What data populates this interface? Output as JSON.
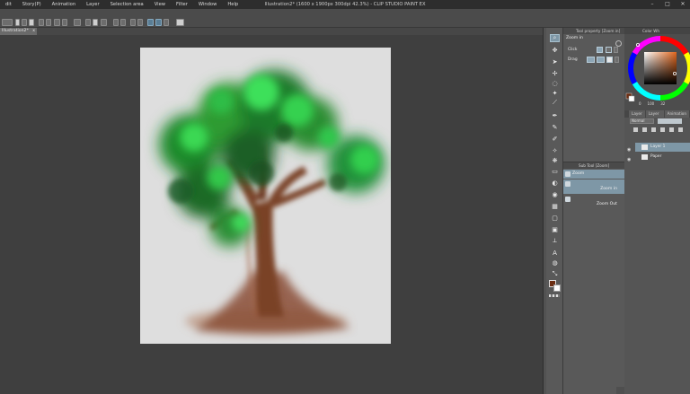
{
  "window": {
    "title": "Illustration2* (1600 x 1900px 300dpi 42.3%) - CLIP STUDIO PAINT EX",
    "minimize": "–",
    "maximize": "□",
    "close": "✕"
  },
  "menu": [
    "dit",
    "Story(P)",
    "Animation",
    "Layer",
    "Selection area",
    "View",
    "Filter",
    "Window",
    "Help"
  ],
  "document_tab": {
    "label": "Illustration2*",
    "close": "x"
  },
  "tool_property": {
    "header": "Tool property [Zoom in]",
    "tool_name": "Zoom in",
    "rows": [
      {
        "label": "Click"
      },
      {
        "label": "Drag"
      }
    ]
  },
  "sub_tool": {
    "header": "Sub Tool [Zoom]",
    "items": [
      {
        "label": "Zoom",
        "selected": true
      },
      {
        "label": "Zoom in",
        "selected": true
      },
      {
        "label": "Zoom Out",
        "selected": false
      }
    ]
  },
  "color_panel": {
    "header": "Color Wh",
    "hsv": [
      "0",
      "100",
      "32"
    ],
    "current_color": "#6b2d12",
    "sub_color": "#ffffff"
  },
  "layer_panel": {
    "tabs": [
      "Layer",
      "Layer Pr",
      "Animation"
    ],
    "blend_mode": "Normal",
    "layers": [
      {
        "name": "Layer 1",
        "selected": true
      },
      {
        "name": "Paper",
        "selected": false
      }
    ]
  },
  "colors": {
    "canvas_bg": "#dedede",
    "ui_dark": "#3f3f3f",
    "selection": "#7e97a6"
  }
}
